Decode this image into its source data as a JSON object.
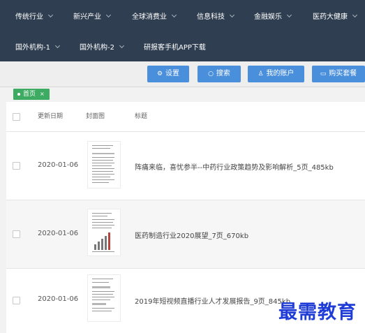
{
  "nav": {
    "row1": [
      {
        "label": "传统行业"
      },
      {
        "label": "新兴产业"
      },
      {
        "label": "全球消费业"
      },
      {
        "label": "信息科技"
      },
      {
        "label": "金融娱乐"
      },
      {
        "label": "医药大健康"
      }
    ],
    "row2": [
      {
        "label": "国外机构-1"
      },
      {
        "label": "国外机构-2"
      },
      {
        "label": "研报客手机APP下载"
      }
    ]
  },
  "toolbar": {
    "settings": "设置",
    "search": "搜索",
    "account": "我的账户",
    "buy": "购买套餐"
  },
  "tabs": {
    "home": "首页",
    "close": "×"
  },
  "table": {
    "headers": {
      "date": "更新日期",
      "cover": "封面图",
      "title": "标题"
    },
    "rows": [
      {
        "date": "2020-01-06",
        "title": "阵痛来临，喜忧参半--中药行业政策趋势及影响解析_5页_485kb"
      },
      {
        "date": "2020-01-06",
        "title": "医药制造行业2020展望_7页_670kb"
      },
      {
        "date": "2020-01-06",
        "title": "2019年短视频直播行业人才发展报告_9页_845kb"
      }
    ]
  },
  "watermark": "最需教育",
  "colors": {
    "nav_bg": "#2f3e50",
    "button_bg": "#4a8fdc",
    "tag_bg": "#3eab63",
    "watermark": "#1f3cd6"
  }
}
